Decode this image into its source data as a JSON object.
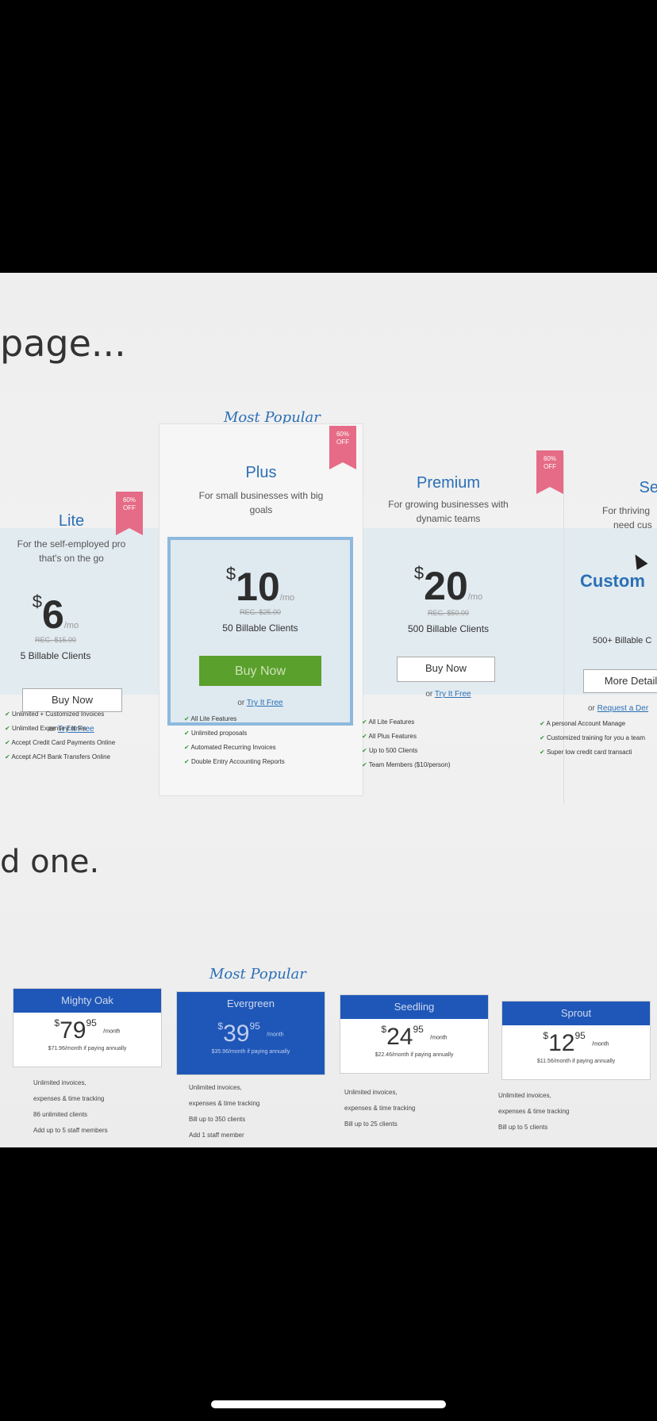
{
  "headings": {
    "top": "page...",
    "bottom": "d one."
  },
  "plans": [
    {
      "name": "Lite",
      "desc1": "For the self-employed pro",
      "desc2": "that's on the go",
      "currency": "$",
      "amount": "6",
      "per": "/mo",
      "reg": "REG. $15.00",
      "clients": "5 Billable Clients",
      "button": "Buy Now",
      "try_prefix": "or ",
      "try_link": "Try It Free",
      "ribbon": "60% OFF"
    },
    {
      "name": "Plus",
      "desc1": "For small businesses with big",
      "desc2": "goals",
      "currency": "$",
      "amount": "10",
      "per": "/mo",
      "reg": "REG. $25.00",
      "clients": "50 Billable Clients",
      "button": "Buy Now",
      "try_prefix": "or ",
      "try_link": "Try It Free",
      "ribbon": "60% OFF",
      "badge": "Most Popular"
    },
    {
      "name": "Premium",
      "desc1": "For growing businesses with",
      "desc2": "dynamic teams",
      "currency": "$",
      "amount": "20",
      "per": "/mo",
      "reg": "REG. $50.00",
      "clients": "500 Billable Clients",
      "button": "Buy Now",
      "try_prefix": "or ",
      "try_link": "Try It Free",
      "ribbon": "60% OFF"
    },
    {
      "name": "Se",
      "desc1": "For thriving",
      "desc2": "need cus",
      "amount": "Custom",
      "clients": "500+ Billable C",
      "button": "More Detail",
      "try_prefix": "or ",
      "try_link": "Request a Der"
    }
  ],
  "features": {
    "lite": [
      "Unlimited + Customized Invoices",
      "Unlimited Expense Entries",
      "Accept Credit Card Payments Online",
      "Accept ACH Bank Transfers Online"
    ],
    "plus": [
      "All Lite Features",
      "Unlimited proposals",
      "Automated Recurring Invoices",
      "Double Entry Accounting Reports"
    ],
    "premium": [
      "All Lite Features",
      "All Plus Features",
      "Up to 500 Clients",
      "Team Members ($10/person)"
    ],
    "select": [
      "A personal Account Manage",
      "Customized training for you a team",
      "Super low credit card transacti"
    ]
  },
  "tiers_badge": "Most Popular",
  "tiers": [
    {
      "name": "Mighty Oak",
      "cur": "$",
      "amount": "79",
      "cents": "95",
      "per": "/month",
      "note": "$71.96/month if paying annually",
      "features": [
        "Unlimited invoices,",
        "expenses & time tracking",
        "86 unlimited clients",
        "Add up to 5 staff members"
      ]
    },
    {
      "name": "Evergreen",
      "cur": "$",
      "amount": "39",
      "cents": "95",
      "per": "/month",
      "note": "$35.96/month if paying annually",
      "features": [
        "Unlimited invoices,",
        "expenses & time tracking",
        "Bill up to 350 clients",
        "Add 1 staff member"
      ]
    },
    {
      "name": "Seedling",
      "cur": "$",
      "amount": "24",
      "cents": "95",
      "per": "/month",
      "note": "$22.46/month if paying annually",
      "features": [
        "Unlimited invoices,",
        "expenses & time tracking",
        "Bill up to 25 clients"
      ]
    },
    {
      "name": "Sprout",
      "cur": "$",
      "amount": "12",
      "cents": "95",
      "per": "/month",
      "note": "$11.56/month if paying annually",
      "features": [
        "Unlimited invoices,",
        "expenses & time tracking",
        "Bill up to 5 clients"
      ]
    }
  ],
  "colors": {
    "accent": "#2a6fb5",
    "buy_green": "#5aa02c",
    "tier_blue": "#1f57b8",
    "ribbon": "#e56b86"
  }
}
